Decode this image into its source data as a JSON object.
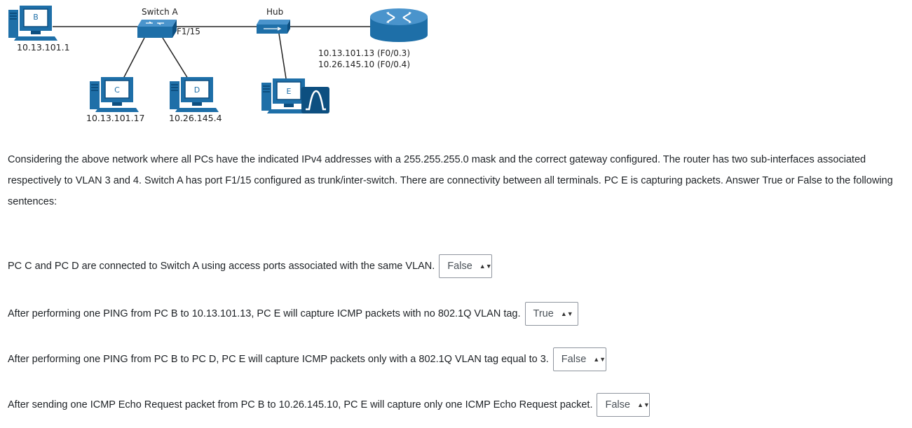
{
  "diagram": {
    "devices": {
      "pc_b": {
        "label": "B",
        "ip": "10.13.101.1"
      },
      "pc_c": {
        "label": "C",
        "ip": "10.13.101.17"
      },
      "pc_d": {
        "label": "D",
        "ip": "10.26.145.4"
      },
      "pc_e": {
        "label": "E"
      },
      "switch_a": {
        "label": "Switch A",
        "port": "F1/15"
      },
      "hub": {
        "label": "Hub"
      },
      "router": {
        "ip_line1": "10.13.101.13 (F0/0.3)",
        "ip_line2": "10.26.145.10 (F0/0.4)"
      }
    },
    "colors": {
      "device_blue": "#1e6fa8",
      "device_dark": "#0d4f80",
      "link": "#222222"
    }
  },
  "intro_text": "Considering the above network where all PCs have the indicated IPv4 addresses with a 255.255.255.0 mask and the correct gateway configured. The router has two sub-interfaces associated respectively to VLAN 3 and 4. Switch A has port F1/15 configured as trunk/inter-switch. There are connectivity between all terminals. PC E is capturing packets. Answer True or False to the following sentences:",
  "questions": [
    {
      "text": "PC C and PC D are connected to Switch A using access ports associated with the same VLAN.",
      "selected": "False"
    },
    {
      "text": "After performing one PING from PC B to 10.13.101.13, PC E will capture ICMP packets with no 802.1Q VLAN tag.",
      "selected": "True"
    },
    {
      "text": "After performing one PING from PC B to PC D, PC E will capture ICMP packets only with a 802.1Q VLAN tag equal to 3.",
      "selected": "False"
    },
    {
      "text": "After sending one ICMP Echo Request packet from PC B to 10.26.145.10, PC E will capture only one ICMP Echo Request packet.",
      "selected": "False"
    }
  ]
}
